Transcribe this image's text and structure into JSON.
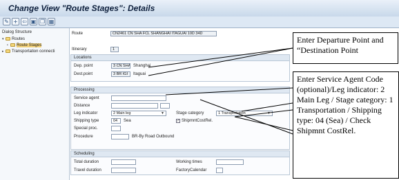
{
  "window": {
    "title": "Change View \"Route Stages\": Details"
  },
  "toolbar": {
    "icons": [
      "edit-icon",
      "new-entries-icon",
      "navigate-back-icon",
      "save-icon",
      "copy-icon",
      "delete-icon"
    ]
  },
  "sidebar": {
    "header": "Dialog Structure",
    "items": [
      {
        "label": "Routes",
        "level": 0,
        "expanded": true,
        "selected": false
      },
      {
        "label": "Route Stages",
        "level": 1,
        "expanded": false,
        "selected": true
      },
      {
        "label": "Transportation connecti",
        "level": 0,
        "expanded": false,
        "selected": false
      }
    ]
  },
  "route": {
    "label": "Route",
    "value": "CN2461 CN SHA FCL SHANGHAI ITAGUAI 10D 34D"
  },
  "itinerary": {
    "label": "Itinerary",
    "value": "1"
  },
  "locations": {
    "title": "Locations",
    "departure_label": "Dep. point",
    "departure_code": "3 CN SHA",
    "departure_name": "Shanghai",
    "destination_label": "Dest.point",
    "destination_code": "3 BR IGI",
    "destination_name": "Itaguai"
  },
  "processing": {
    "title": "Processing",
    "service_agent_label": "Service agent",
    "service_agent_value": "",
    "distance_label": "Distance",
    "distance_value": "",
    "leg_indicator_label": "Leg indicator",
    "leg_indicator_value": "2 Main leg",
    "stage_category_label": "Stage category",
    "stage_category_value": "1 Transportation",
    "shipping_type_label": "Shipping type",
    "shipping_type_code": "04",
    "shipping_type_name": "Sea",
    "shipmnt_cost_rel_label": "ShipmntCostRel.",
    "shipmnt_cost_rel_checked": true,
    "special_proc_label": "Special proc.",
    "special_proc_value": "",
    "procedure_label": "Procedure",
    "procedure_value": "BR-By Road Outbound"
  },
  "scheduling": {
    "title": "Scheduling",
    "total_duration_label": "Total duration",
    "travel_duration_label": "Travel duration",
    "working_times_label": "Working times",
    "factory_calendar_label": "FactoryCalendar"
  },
  "callouts": {
    "departure_destination": "Enter Departure Point and “Destination Point",
    "processing": "Enter Service Agent Code (optional)/Leg indicator: 2 Main Leg / Stage category: 1 Transportation / Shipping type: 04 (Sea) / Check Shipmnt CostRel."
  }
}
